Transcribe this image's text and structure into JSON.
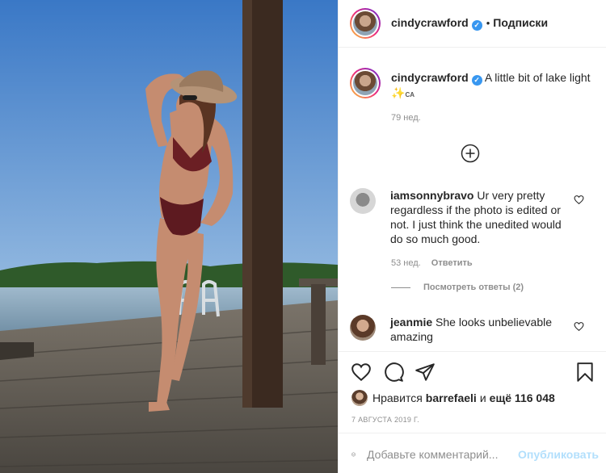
{
  "post": {
    "author": "cindycrawford",
    "follow_status": "Подписки",
    "separator": "•",
    "caption": {
      "text": "A little bit of lake light",
      "emoji": "✨",
      "flag_text": "CA"
    },
    "caption_time": "79 нед.",
    "comments": [
      {
        "user": "iamsonnybravo",
        "text": "Ur very pretty regardless if the photo is edited or not. I just think the unedited would do so much good.",
        "time": "53 нед.",
        "reply_label": "Ответить",
        "view_replies": "Посмотреть ответы (2)"
      },
      {
        "user": "jeanmie",
        "text": "She looks unbelievable amazing"
      }
    ],
    "likes": {
      "prefix": "Нравится",
      "user": "barrefaeli",
      "connector": "и",
      "others": "ещё 116 048"
    },
    "date": "7 АВГУСТА 2019 Г.",
    "add_comment": {
      "placeholder": "Добавьте комментарий...",
      "publish_label": "Опубликовать"
    }
  },
  "colors": {
    "sky": "#4f8bd0",
    "verified": "#3897f0",
    "publish_disabled": "#b2dffc"
  },
  "icons": {
    "load_more": "plus-circle-icon",
    "like": "heart-icon",
    "comment": "comment-icon",
    "share": "share-icon",
    "save": "bookmark-icon",
    "emoji": "smiley-icon"
  }
}
